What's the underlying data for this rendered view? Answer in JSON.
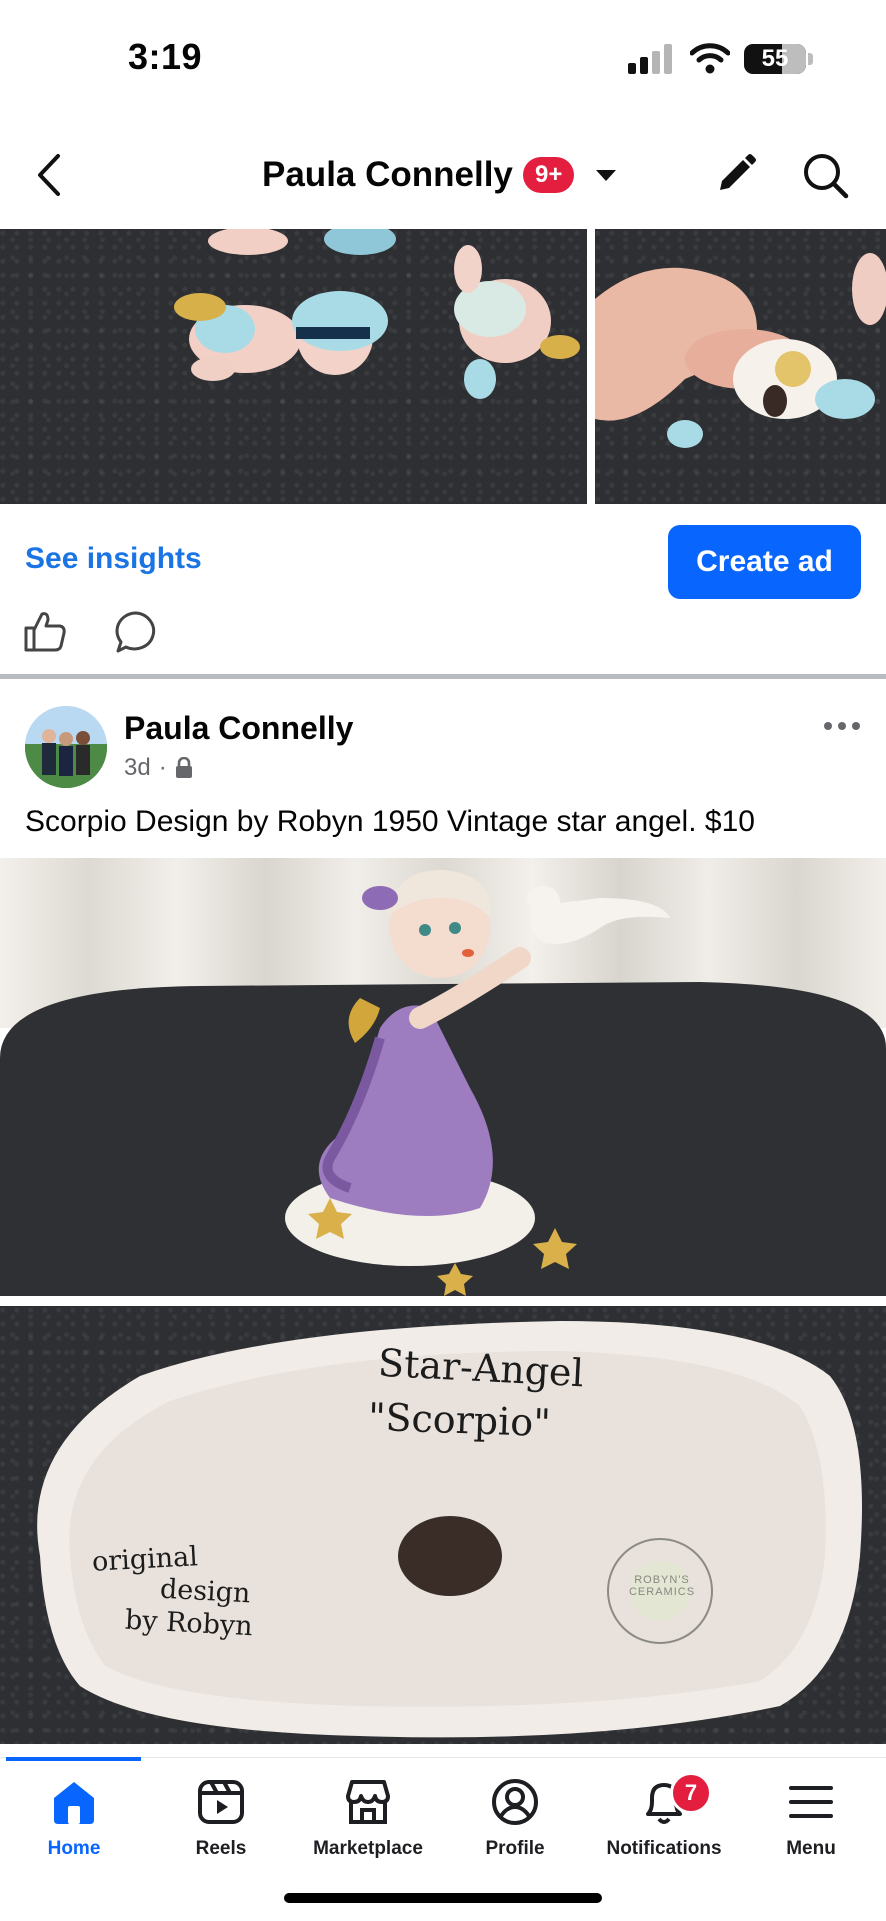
{
  "status_bar": {
    "time": "3:19",
    "battery": "55"
  },
  "header": {
    "title": "Paula Connelly",
    "badge": "9+"
  },
  "previous_post": {
    "see_insights": "See insights",
    "create_ad": "Create ad"
  },
  "post": {
    "author": "Paula Connelly",
    "age": "3d",
    "separator": "·",
    "text": "Scorpio  Design by Robyn 1950 Vintage star angel. $10",
    "photo2_inscription": {
      "line1": "Star-Angel",
      "line2": "\"Scorpio\"",
      "left1": "original",
      "left2": "design",
      "left3": "by Robyn",
      "stamp": "ROBYN'S CERAMICS"
    }
  },
  "tabbar": {
    "items": [
      {
        "label": "Home",
        "icon": "home-icon"
      },
      {
        "label": "Reels",
        "icon": "reels-icon"
      },
      {
        "label": "Marketplace",
        "icon": "marketplace-icon"
      },
      {
        "label": "Profile",
        "icon": "profile-icon"
      },
      {
        "label": "Notifications",
        "icon": "bell-icon"
      },
      {
        "label": "Menu",
        "icon": "menu-icon"
      }
    ],
    "notifications_badge": "7"
  },
  "colors": {
    "brand_blue": "#0866ff",
    "link_blue": "#1b74e4",
    "badge_red": "#e41e3f"
  }
}
